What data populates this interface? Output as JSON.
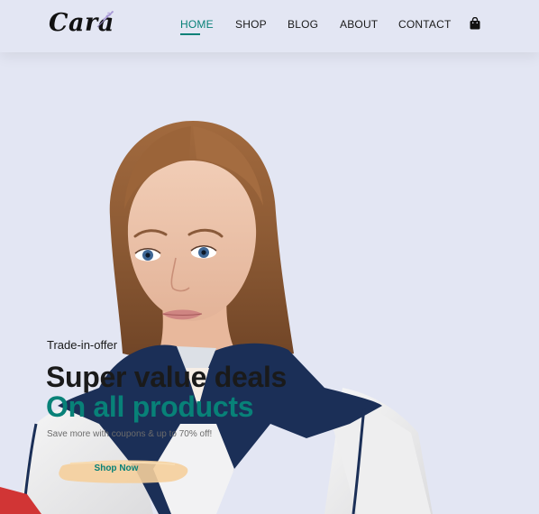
{
  "brand": {
    "logo_text": "Cara",
    "logo_icon": "lavender-sprig-icon"
  },
  "nav": {
    "items": [
      {
        "label": "HOME",
        "active": true
      },
      {
        "label": "SHOP",
        "active": false
      },
      {
        "label": "BLOG",
        "active": false
      },
      {
        "label": "ABOUT",
        "active": false
      },
      {
        "label": "CONTACT",
        "active": false
      }
    ],
    "cart_icon": "shopping-bag-icon"
  },
  "hero": {
    "eyebrow": "Trade-in-offer",
    "headline": "Super value deals",
    "subheadline": "On all products",
    "description": "Save more with coupons & up to 70% off!",
    "cta_label": "Shop Now"
  },
  "colors": {
    "accent": "#088178",
    "background": "#e3e6f3",
    "button_brush": "#f5cf9c",
    "jacket_navy": "#1b2f57"
  }
}
